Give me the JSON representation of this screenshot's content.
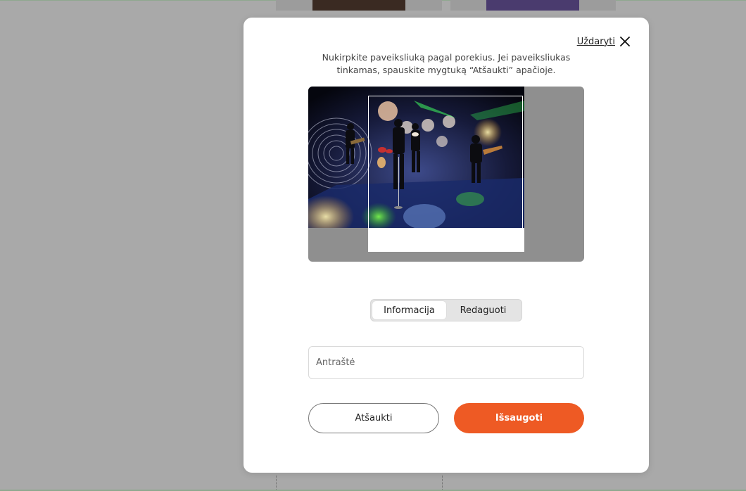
{
  "modal": {
    "close_label": "Uždaryti",
    "instructions": "Nukirpkite paveiksliuką pagal porekius. Jei paveiksliukas tinkamas, spauskite mygtuką “Atšaukti” apačioje.",
    "tabs": [
      {
        "label": "Informacija",
        "active": true
      },
      {
        "label": "Redaguoti",
        "active": false
      }
    ],
    "title_field": {
      "placeholder": "Antraštė",
      "value": ""
    },
    "cancel_label": "Atšaukti",
    "save_label": "Išsaugoti"
  },
  "colors": {
    "accent": "#ee5a24",
    "overlay": "#a9a9a9",
    "crop_background": "#8f8f8f"
  }
}
